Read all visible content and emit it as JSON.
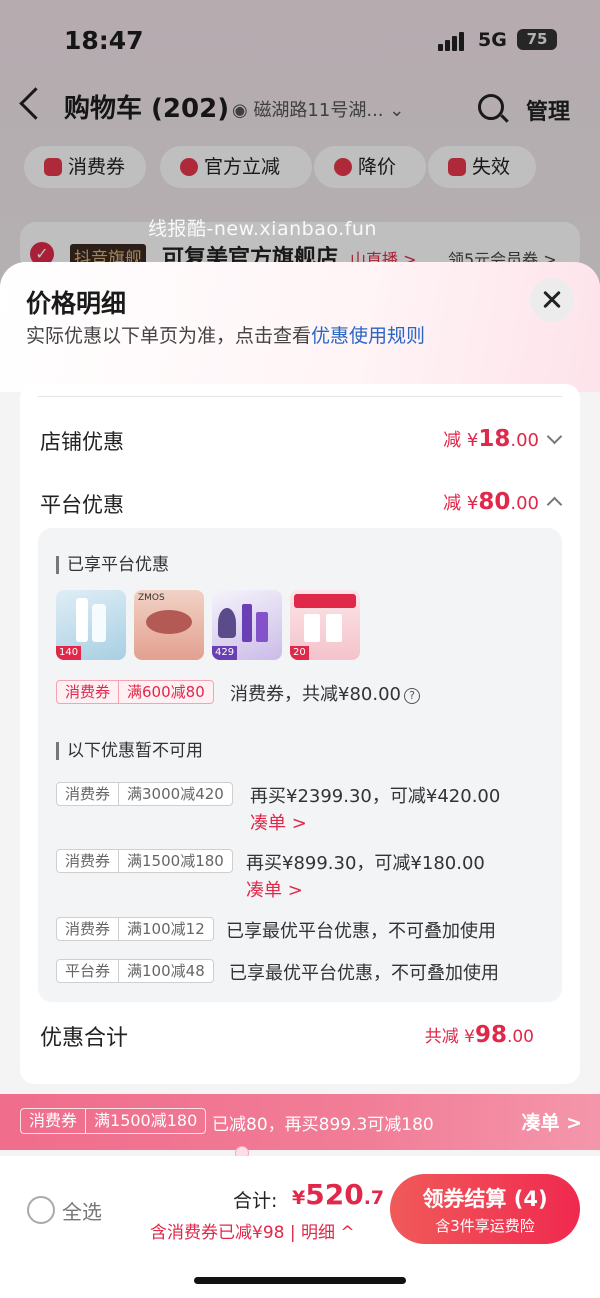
{
  "status": {
    "time": "18:47",
    "network": "5G",
    "battery": "75"
  },
  "header": {
    "title": "购物车 (202)",
    "address": "磁湖路11号湖...",
    "manage": "管理"
  },
  "filter_chips": [
    {
      "label": "消费券",
      "color": "#e8394f"
    },
    {
      "label": "官方立减",
      "color": "#e8394f"
    },
    {
      "label": "降价",
      "color": "#e8394f"
    },
    {
      "label": "失效",
      "color": "#e8394f"
    }
  ],
  "store": {
    "tag": "抖音旗舰",
    "name": "可复美官方旗舰店",
    "live": "山直播 >",
    "vip": "领5元会员券 >"
  },
  "watermark": "线报酷-new.xianbao.fun",
  "sheet": {
    "title": "价格明细",
    "subtitle": "实际优惠以下单页为准，点击查看",
    "rules_link": "优惠使用规则",
    "store_discount": {
      "label": "店铺优惠",
      "prefix": "减 ¥",
      "int": "18",
      "dec": ".00"
    },
    "platform_discount": {
      "label": "平台优惠",
      "prefix": "减 ¥",
      "int": "80",
      "dec": ".00"
    },
    "enjoyed": {
      "title": "已享平台优惠",
      "thumb_labels": [
        "140",
        "ZMOS",
        "429",
        "20"
      ],
      "coupon_tag": [
        "消费券",
        "满600减80"
      ],
      "coupon_text": "消费券，共减¥80.00",
      "help_icon": "?"
    },
    "unavailable": {
      "title": "以下优惠暂不可用",
      "items": [
        {
          "tag": [
            "消费券",
            "满3000减420"
          ],
          "text": "再买¥2399.30，可减¥420.00",
          "link": "凑单 >"
        },
        {
          "tag": [
            "消费券",
            "满1500减180"
          ],
          "text": "再买¥899.30，可减¥180.00",
          "link": "凑单 >"
        },
        {
          "tag": [
            "消费券",
            "满100减12"
          ],
          "text": "已享最优平台优惠，不可叠加使用"
        },
        {
          "tag": [
            "平台券",
            "满100减48"
          ],
          "text": "已享最优平台优惠，不可叠加使用"
        }
      ]
    },
    "total": {
      "label": "优惠合计",
      "prefix": "共减 ¥",
      "int": "98",
      "dec": ".00"
    }
  },
  "promo_bar": {
    "tag": [
      "消费券",
      "满1500减180"
    ],
    "text": "已减80，再买899.3可减180",
    "action": "凑单 >"
  },
  "bottom": {
    "select_all": "全选",
    "sum_label": "合计:",
    "sum_yen": "¥",
    "sum_int": "520",
    "sum_dec": ".7",
    "sum_sub": "含消费券已减¥98 | 明细 ^",
    "pay_main": "领券结算 (4)",
    "pay_sub": "含3件享运费险"
  },
  "colors": {
    "accent": "#e0284a",
    "link": "#2a66c4"
  }
}
